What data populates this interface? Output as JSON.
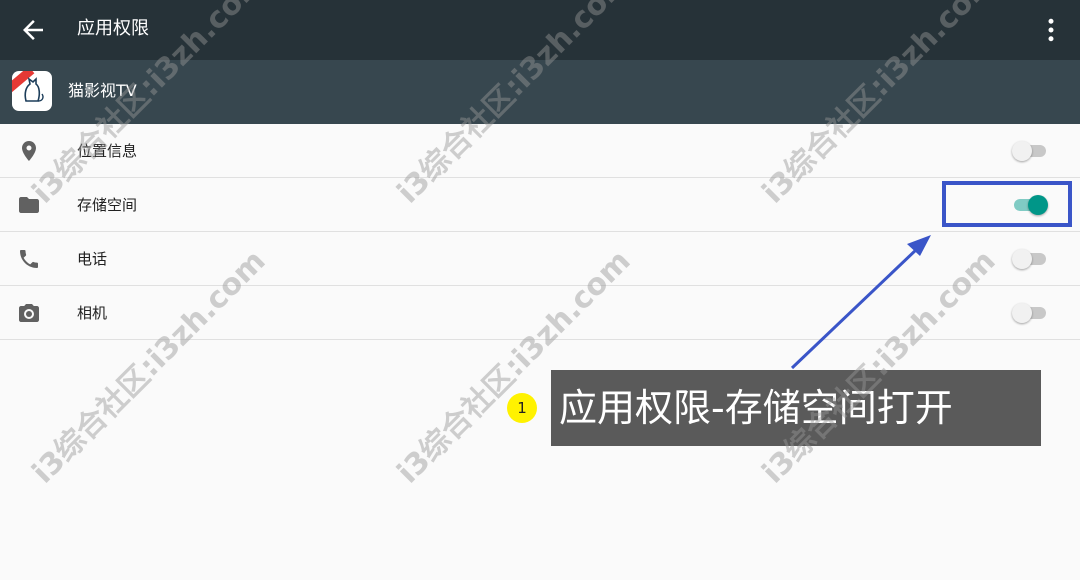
{
  "appbar": {
    "title": "应用权限",
    "back_icon": "arrow-back-icon",
    "more_icon": "more-vert-icon"
  },
  "app": {
    "name": "猫影视TV",
    "icon": "cat-app-icon"
  },
  "permissions": [
    {
      "label": "位置信息",
      "icon": "location-pin-icon",
      "enabled": false
    },
    {
      "label": "存储空间",
      "icon": "folder-icon",
      "enabled": true
    },
    {
      "label": "电话",
      "icon": "phone-icon",
      "enabled": false
    },
    {
      "label": "相机",
      "icon": "camera-icon",
      "enabled": false
    }
  ],
  "annotation": {
    "step": "1",
    "text": "应用权限-存储空间打开"
  },
  "watermark": "i3综合社区:i3zh.com",
  "colors": {
    "appbar": "#263238",
    "app_header": "#37474f",
    "toggle_on": "#009688",
    "highlight": "#3a55c8",
    "callout_bg": "#5a5a5a",
    "badge": "#fff200"
  }
}
